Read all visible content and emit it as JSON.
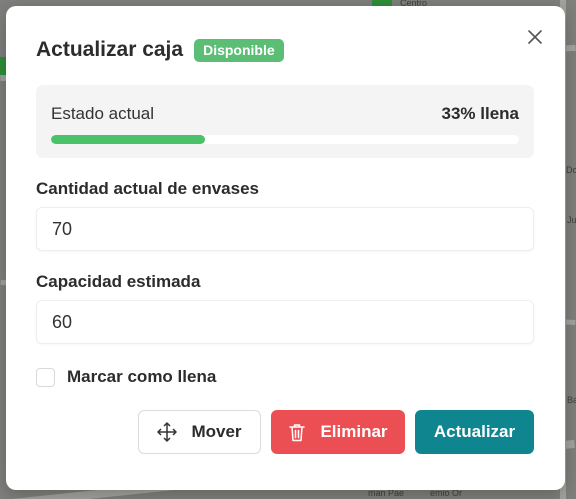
{
  "map": {
    "labels": [
      "Centro",
      "Doctor",
      "Ju",
      "Ba",
      "man Pae",
      "emio Or"
    ]
  },
  "modal": {
    "title": "Actualizar caja",
    "status_badge": "Disponible",
    "close_icon": "close-icon",
    "status": {
      "label": "Estado actual",
      "value_text": "33% llena",
      "fill_fraction": 0.33,
      "fill_color": "#49c26a"
    },
    "fields": [
      {
        "label": "Cantidad actual de envases",
        "value": "70"
      },
      {
        "label": "Capacidad estimada",
        "value": "60"
      }
    ],
    "checkbox": {
      "label": "Marcar como llena",
      "checked": false
    },
    "buttons": {
      "move": {
        "label": "Mover",
        "icon": "move-arrows-icon"
      },
      "delete": {
        "label": "Eliminar",
        "icon": "trash-icon",
        "color": "#ec4f53"
      },
      "update": {
        "label": "Actualizar",
        "color": "#0f868f"
      }
    },
    "badge_color": "#5cbe74"
  }
}
